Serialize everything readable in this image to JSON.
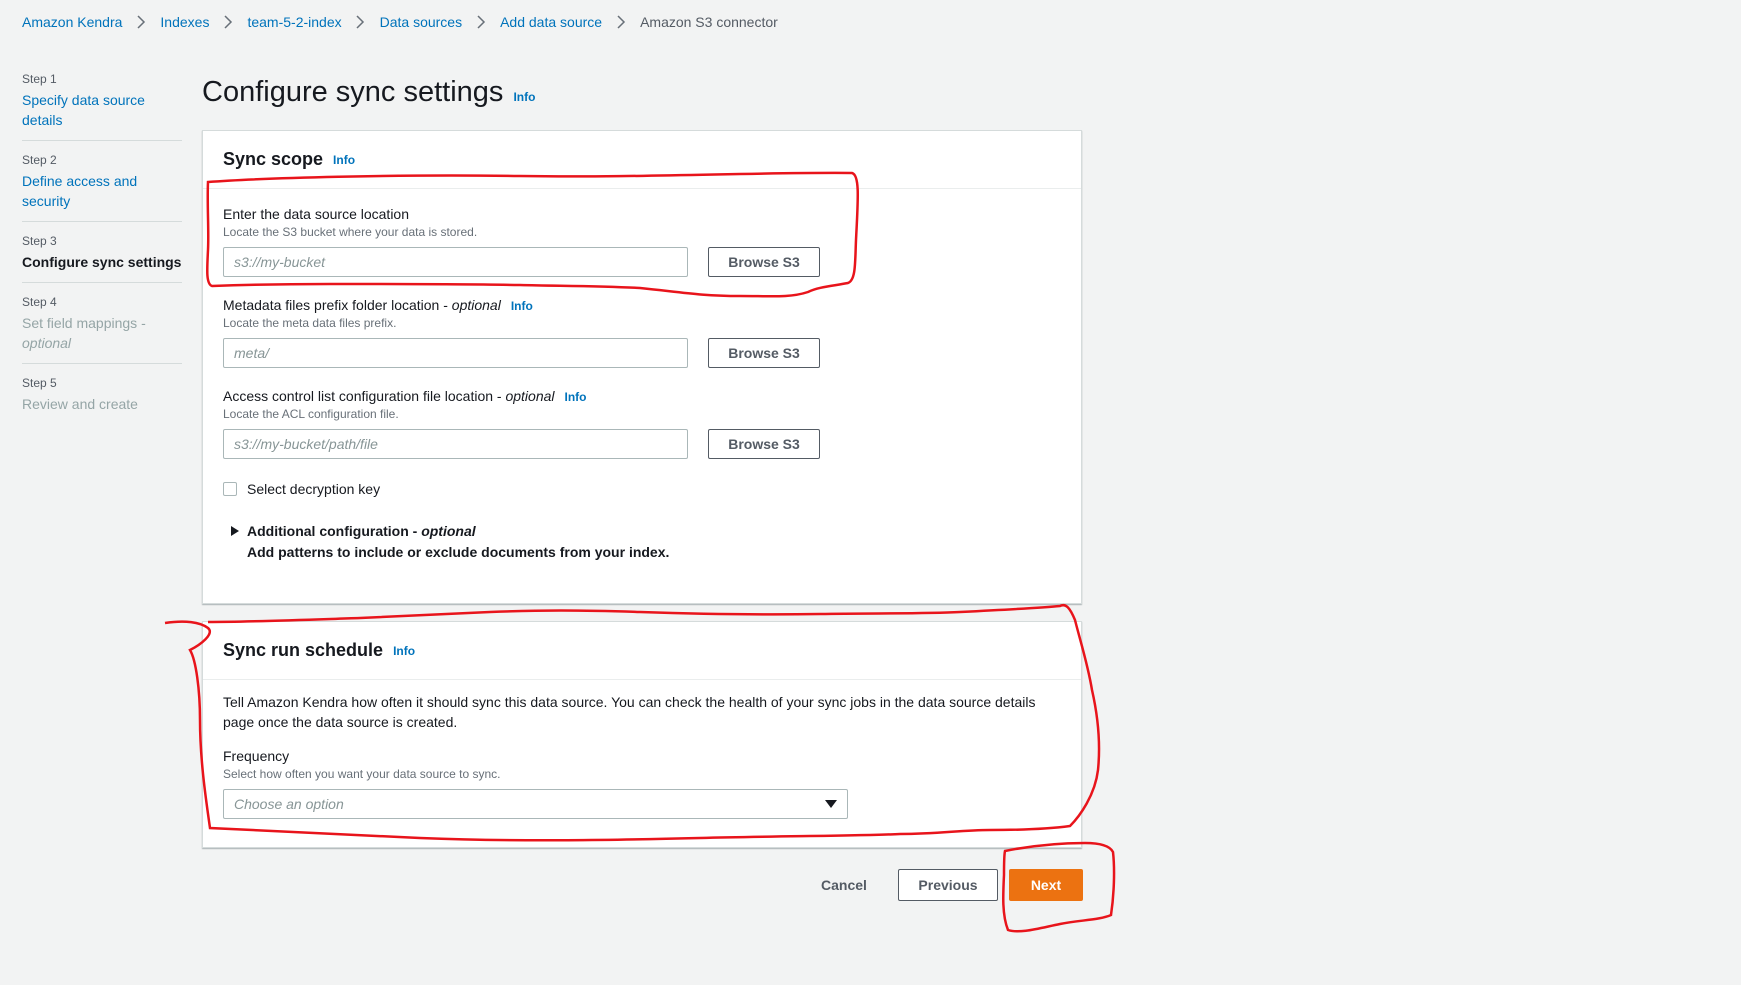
{
  "breadcrumb": [
    {
      "label": "Amazon Kendra"
    },
    {
      "label": "Indexes"
    },
    {
      "label": "team-5-2-index"
    },
    {
      "label": "Data sources"
    },
    {
      "label": "Add data source"
    },
    {
      "label": "Amazon S3 connector"
    }
  ],
  "steps": [
    {
      "num": "Step 1",
      "title": "Specify data source details",
      "state": "link"
    },
    {
      "num": "Step 2",
      "title": "Define access and security",
      "state": "link"
    },
    {
      "num": "Step 3",
      "title": "Configure sync settings",
      "state": "active"
    },
    {
      "num": "Step 4",
      "title": "Set field mappings - ",
      "title_italic": "optional",
      "state": "disabled"
    },
    {
      "num": "Step 5",
      "title": "Review and create",
      "state": "disabled"
    }
  ],
  "page": {
    "title": "Configure sync settings",
    "info": "Info"
  },
  "sync_scope": {
    "title": "Sync scope",
    "info": "Info",
    "location": {
      "label": "Enter the data source location",
      "description": "Locate the S3 bucket where your data is stored.",
      "placeholder": "s3://my-bucket",
      "button": "Browse S3"
    },
    "metadata": {
      "label": "Metadata files prefix folder location - ",
      "label_optional": "optional",
      "info": "Info",
      "description": "Locate the meta data files prefix.",
      "placeholder": "meta/",
      "button": "Browse S3"
    },
    "acl": {
      "label": "Access control list configuration file location - ",
      "label_optional": "optional",
      "info": "Info",
      "description": "Locate the ACL configuration file.",
      "placeholder": "s3://my-bucket/path/file",
      "button": "Browse S3"
    },
    "decryption_checkbox": "Select decryption key",
    "additional": {
      "title": "Additional configuration - ",
      "title_optional": "optional",
      "description": "Add patterns to include or exclude documents from your index."
    }
  },
  "schedule": {
    "title": "Sync run schedule",
    "info": "Info",
    "description": "Tell Amazon Kendra how often it should sync this data source. You can check the health of your sync jobs in the data source details page once the data source is created.",
    "frequency_label": "Frequency",
    "frequency_description": "Select how often you want your data source to sync.",
    "frequency_placeholder": "Choose an option"
  },
  "footer": {
    "cancel": "Cancel",
    "previous": "Previous",
    "next": "Next"
  },
  "colors": {
    "link": "#0073bb",
    "primary": "#ec7211",
    "annotation": "#e8141b",
    "background": "#f2f3f3"
  }
}
